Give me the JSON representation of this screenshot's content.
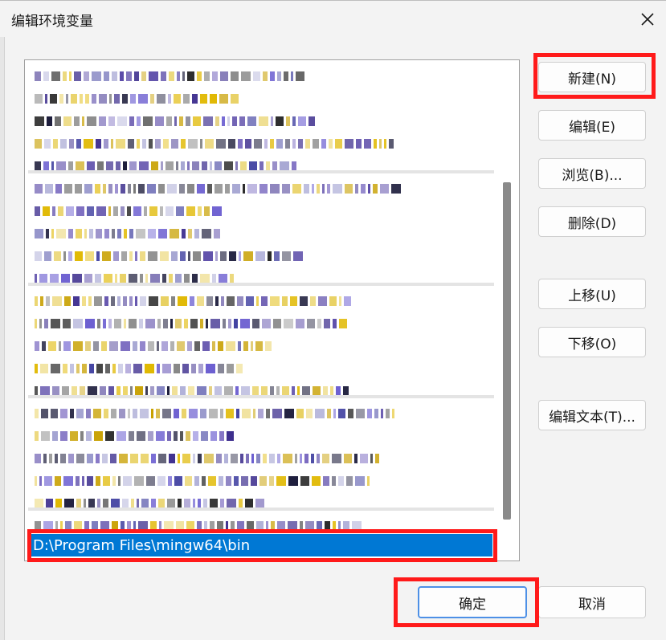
{
  "window": {
    "title": "编辑环境变量",
    "close_icon": "×"
  },
  "list": {
    "selected_value": "D:\\Program Files\\mingw64\\bin"
  },
  "buttons": {
    "new": "新建(N)",
    "edit": "编辑(E)",
    "browse": "浏览(B)...",
    "delete": "删除(D)",
    "move_up": "上移(U)",
    "move_down": "下移(O)",
    "edit_text": "编辑文本(T)...",
    "ok": "确定",
    "cancel": "取消"
  },
  "colors": {
    "selection": "#0078d4",
    "highlight_box": "#ff1a1a",
    "primary_border": "#4d90e6"
  }
}
